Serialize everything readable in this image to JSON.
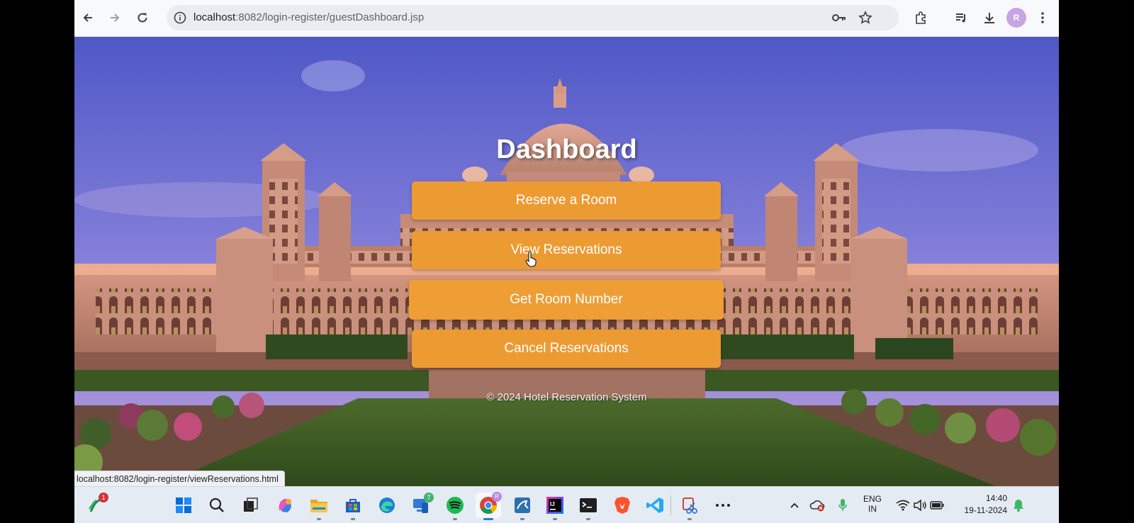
{
  "browser": {
    "url_host": "localhost",
    "url_path": ":8082/login-register/guestDashboard.jsp",
    "status_url": "localhost:8082/login-register/viewReservations.html",
    "profile_initial": "R"
  },
  "page": {
    "title": "Dashboard",
    "buttons": [
      {
        "label": "Reserve a Room"
      },
      {
        "label": "View Reservations"
      },
      {
        "label": "Get Room Number"
      },
      {
        "label": "Cancel Reservations"
      }
    ],
    "footer": "© 2024 Hotel Reservation System",
    "colors": {
      "button": "#ec9b33",
      "sky_top": "#4f58c6",
      "sky_bottom": "#8b83df"
    }
  },
  "taskbar": {
    "widgets_badge": "1",
    "phone_badge": "7",
    "chrome_badge": "R",
    "language_line1": "ENG",
    "language_line2": "IN",
    "time": "14:40",
    "date": "19-11-2024"
  }
}
